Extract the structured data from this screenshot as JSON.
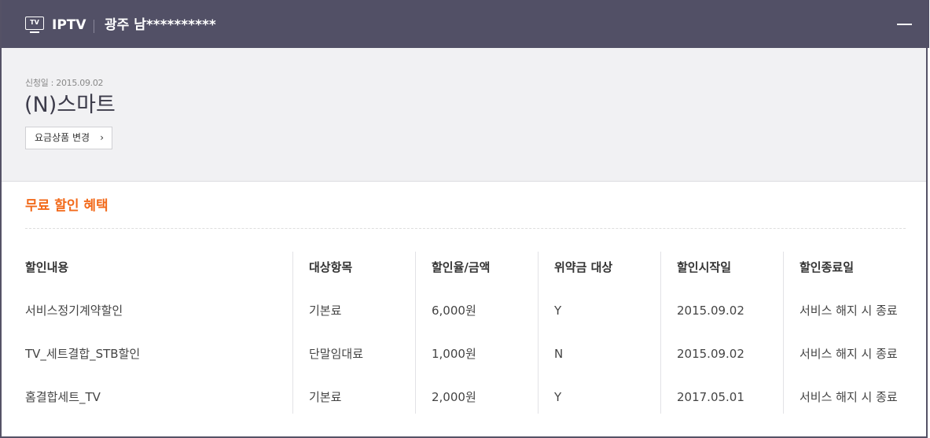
{
  "header": {
    "tv_icon_text": "TV",
    "service": "IPTV",
    "address": "광주 남**********"
  },
  "summary": {
    "apply_date": "신청일 : 2015.09.02",
    "plan_name": "(N)스마트",
    "change_button": "요금상품 변경",
    "change_chevron": "›"
  },
  "benefits": {
    "title": "무료 할인 혜택",
    "columns": [
      "할인내용",
      "대상항목",
      "할인율/금액",
      "위약금 대상",
      "할인시작일",
      "할인종료일"
    ],
    "rows": [
      [
        "서비스정기계약할인",
        "기본료",
        "6,000원",
        "Y",
        "2015.09.02",
        "서비스 해지 시 종료"
      ],
      [
        "TV_세트결합_STB할인",
        "단말임대료",
        "1,000원",
        "N",
        "2015.09.02",
        "서비스 해지 시 종료"
      ],
      [
        "홈결합세트_TV",
        "기본료",
        "2,000원",
        "Y",
        "2017.05.01",
        "서비스 해지 시 종료"
      ]
    ]
  },
  "colors": {
    "header_bg": "#525066",
    "accent": "#f26a1b",
    "summary_bg": "#f1f1f3"
  }
}
